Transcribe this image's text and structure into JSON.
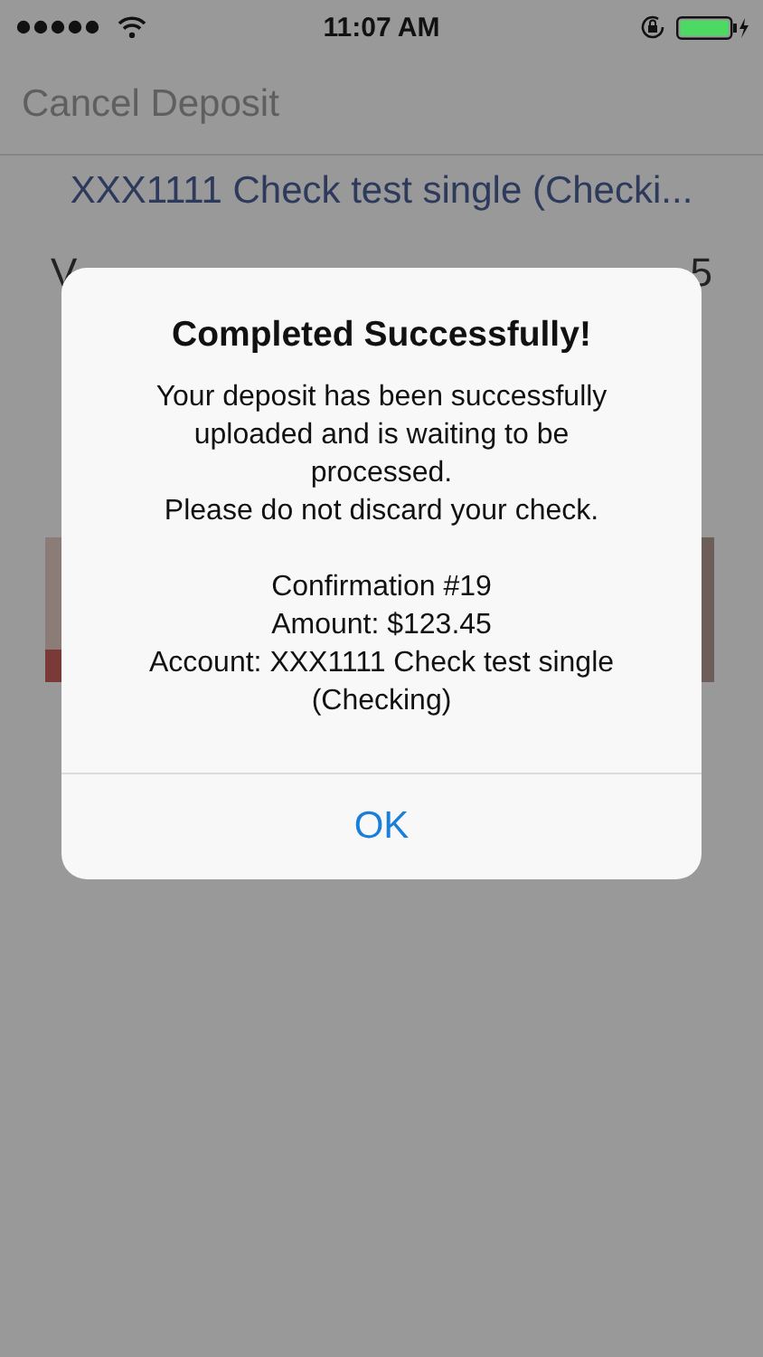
{
  "status_bar": {
    "time": "11:07 AM"
  },
  "nav_bar": {
    "cancel_label": "Cancel Deposit"
  },
  "account_link": "XXX1111 Check test single (Checki...",
  "rows": [
    {
      "label": "V",
      "value": "5"
    }
  ],
  "alert": {
    "title": "Completed Successfully!",
    "message_lines": [
      "Your deposit has been successfully uploaded and is waiting to be processed.",
      "Please do not discard your check."
    ],
    "details_lines": [
      "Confirmation #19",
      "Amount: $123.45",
      "Account: XXX1111 Check test single (Checking)"
    ],
    "buttons": [
      "OK"
    ]
  }
}
